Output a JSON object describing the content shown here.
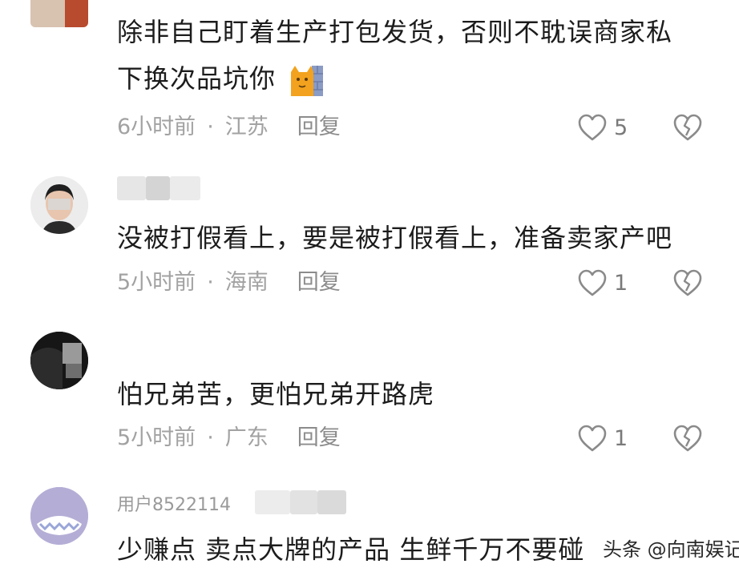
{
  "comments": [
    {
      "lines": [
        "除非自己盯着生产打包发货，否则不耽误商家私",
        "下换次品坑你"
      ],
      "time": "6小时前",
      "dot": "·",
      "location": "江苏",
      "reply_label": "回复",
      "likes": "5"
    },
    {
      "lines": [
        "没被打假看上，要是被打假看上，准备卖家产吧"
      ],
      "time": "5小时前",
      "dot": "·",
      "location": "海南",
      "reply_label": "回复",
      "likes": "1"
    },
    {
      "lines": [
        "怕兄弟苦，更怕兄弟开路虎"
      ],
      "time": "5小时前",
      "dot": "·",
      "location": "广东",
      "reply_label": "回复",
      "likes": "1"
    },
    {
      "username": "用户8522114",
      "lines": [
        "少赚点 卖点大牌的产品  生鲜千万不要碰"
      ]
    }
  ],
  "watermark": "头条 @向南娱记",
  "colors": {
    "text": "#1c1c1c",
    "meta": "#a2a2a2",
    "icon": "#8a8a8a"
  }
}
